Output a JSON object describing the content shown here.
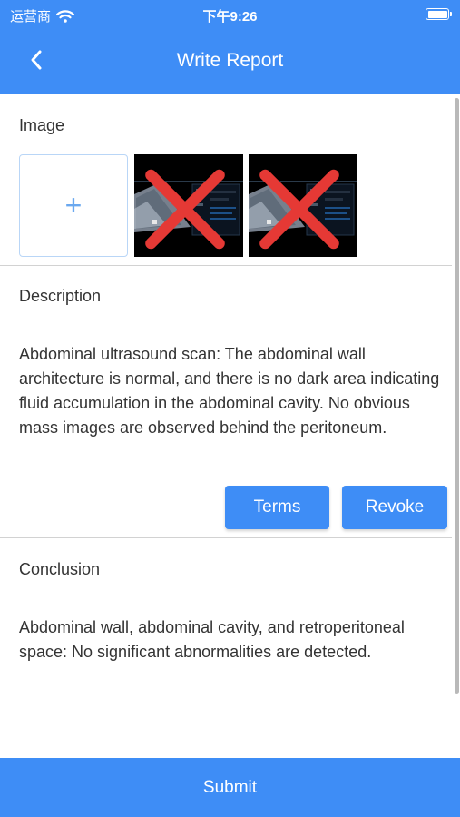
{
  "status_bar": {
    "carrier": "运营商",
    "time": "下午9:26"
  },
  "header": {
    "title": "Write Report"
  },
  "image_section": {
    "label": "Image",
    "add_symbol": "+",
    "thumbnails": [
      {
        "alt": "Ultrasound scan image 1"
      },
      {
        "alt": "Ultrasound scan image 2"
      }
    ]
  },
  "description_section": {
    "label": "Description",
    "text": "Abdominal ultrasound scan: The abdominal wall architecture is normal, and there is no dark area indicating fluid accumulation in the abdominal cavity. No obvious mass images are observed behind the peritoneum.",
    "terms_label": "Terms",
    "revoke_label": "Revoke"
  },
  "conclusion_section": {
    "label": "Conclusion",
    "text": "Abdominal wall, abdominal cavity, and retroperitoneal space: No significant abnormalities are detected."
  },
  "footer": {
    "submit_label": "Submit"
  },
  "colors": {
    "accent": "#3e8df6",
    "delete": "#e53935",
    "divider": "#d2d2d2"
  },
  "icons": [
    "wifi-icon",
    "battery-icon",
    "back-chevron-icon",
    "plus-icon",
    "delete-x-icon"
  ]
}
